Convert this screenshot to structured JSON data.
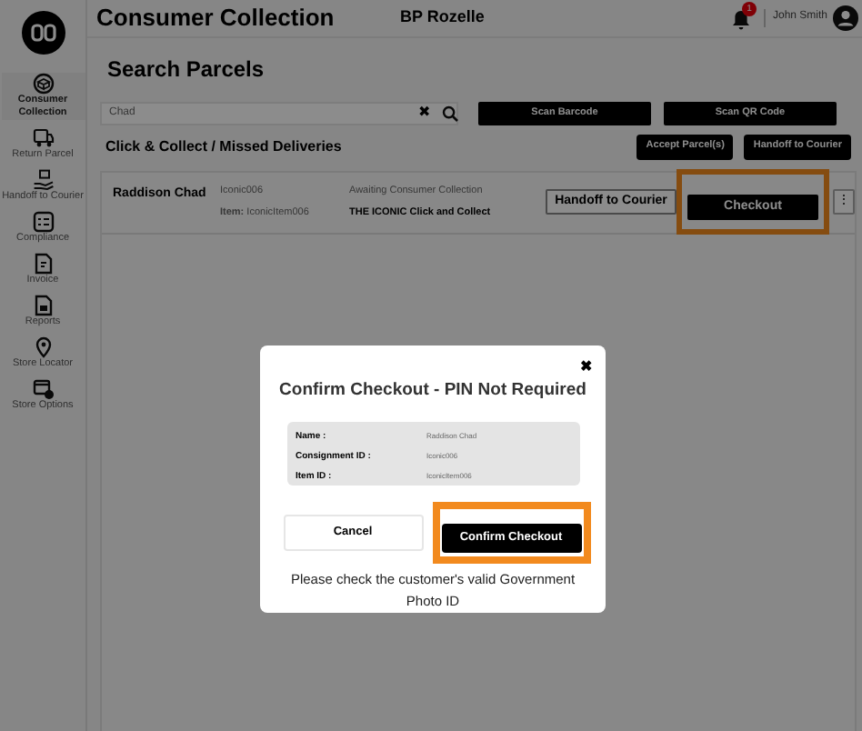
{
  "header": {
    "title": "Consumer Collection",
    "store": "BP Rozelle",
    "notification_count": "1",
    "user": "John Smith"
  },
  "sidebar": {
    "items": [
      {
        "label": "Consumer Collection",
        "selected": true
      },
      {
        "label": "Return Parcel",
        "selected": false
      },
      {
        "label": "Handoff to Courier",
        "selected": false
      },
      {
        "label": "Compliance",
        "selected": false
      },
      {
        "label": "Invoice",
        "selected": false
      },
      {
        "label": "Reports",
        "selected": false
      },
      {
        "label": "Store Locator",
        "selected": false
      },
      {
        "label": "Store Options",
        "selected": false
      }
    ]
  },
  "search": {
    "heading": "Search Parcels",
    "value": "Chad",
    "clear": "✖"
  },
  "scan_buttons": [
    "Scan Barcode",
    "Scan QR Code"
  ],
  "section": {
    "title": "Click & Collect / Missed Deliveries",
    "buttons": [
      "Accept Parcel(s)",
      "Handoff to Courier"
    ]
  },
  "parcels": [
    {
      "name": "Raddison Chad",
      "consignment": "Iconic006",
      "item": "**Item:** IconicItem006",
      "status": "Awaiting Consumer Collection",
      "service": "THE ICONIC Click and Collect",
      "handoff": "Handoff to Courier",
      "checkout": "Checkout",
      "checkout_highlighted": true,
      "more": "⋮"
    }
  ],
  "dialog": {
    "title": "Confirm Checkout - PIN Not Required",
    "close": "✖",
    "fields": [
      {
        "label": "Name :",
        "value": "Raddison Chad"
      },
      {
        "label": "Consignment ID :",
        "value": "Iconic006"
      },
      {
        "label": "Item ID :",
        "value": "IconicItem006"
      }
    ],
    "buttons": [
      {
        "label": "Cancel",
        "kind": "secondary",
        "highlighted": false
      },
      {
        "label": "Confirm Checkout",
        "kind": "primary",
        "highlighted": true
      }
    ],
    "note": "Please check the customer's valid Government Photo ID"
  }
}
